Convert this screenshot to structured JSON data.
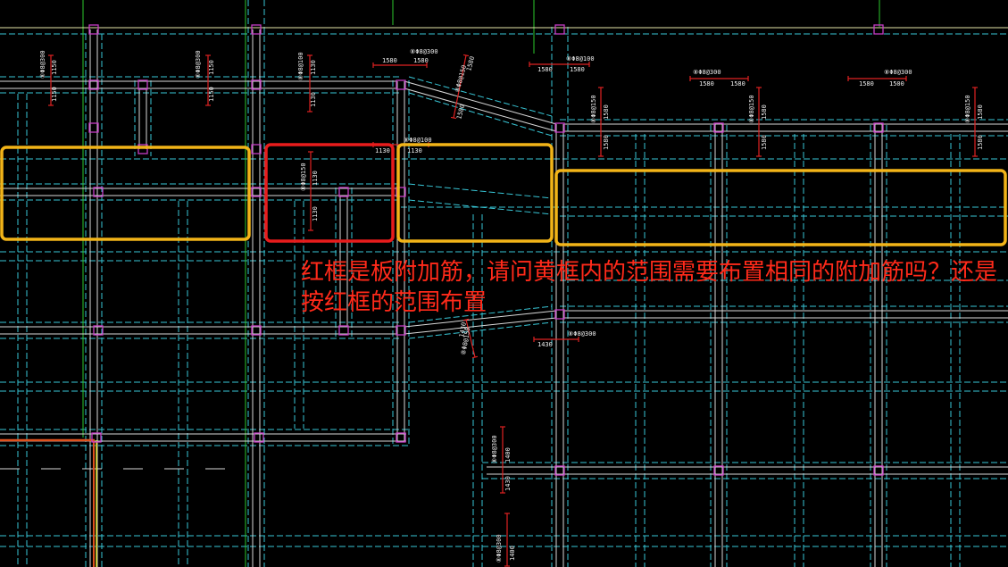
{
  "annotation": {
    "line1": "红框是板附加筋，请问黄框内的范围需要布置相同的附加筋吗？还是",
    "line2": "按红框的范围布置",
    "color": "#ff2a1a"
  },
  "highlight_boxes": {
    "red_color": "#e81c1c",
    "yellow_color": "#f2b418"
  },
  "colors": {
    "background": "#000000",
    "grid_dashed": "#38c6d6",
    "beam_edge": "#d9d9d9",
    "axis_line": "#2cc82c",
    "column": "#c63cc6",
    "rebar": "#e02222"
  },
  "rebar_labels": [
    "⑧Φ8@300",
    "⑧Φ8@300",
    "⑧Φ8@100",
    "⑧Φ8@300",
    "⑧Φ8@150",
    "⑧Φ8@100",
    "⑧Φ8@300",
    "⑧Φ8@300",
    "⑧Φ8@150",
    "⑧Φ8@150",
    "⑧Φ8@150",
    "⑧Φ8@100",
    "⑧Φ8@150",
    "⑧Φ8@150",
    "⑧Φ8@300",
    "⑧Φ8@300",
    "⑧Φ8@300"
  ],
  "dimension_labels": [
    "1150",
    "1150",
    "1150",
    "1150",
    "1130",
    "1130",
    "1580",
    "1580",
    "1580",
    "1580",
    "1580",
    "1580",
    "1580",
    "1580",
    "1580",
    "1500",
    "1580",
    "1580",
    "1580",
    "1580",
    "1580",
    "1580",
    "1130",
    "1130",
    "1130",
    "1130",
    "1430",
    "1430",
    "1400",
    "1430",
    "1400"
  ]
}
